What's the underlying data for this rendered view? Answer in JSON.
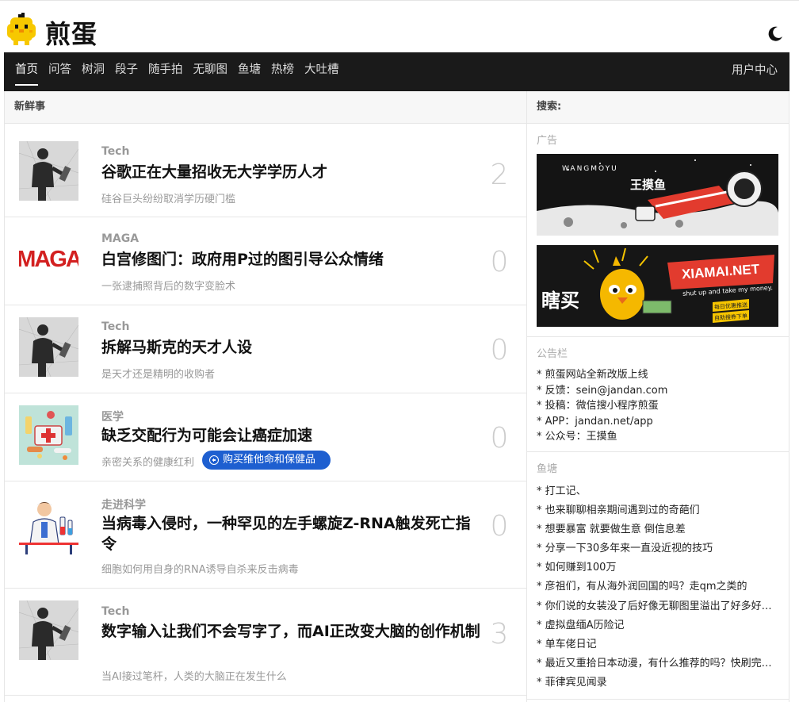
{
  "header": {
    "logo_text": "煎蛋"
  },
  "nav": {
    "items": [
      "首页",
      "问答",
      "树洞",
      "段子",
      "随手拍",
      "无聊图",
      "鱼塘",
      "热榜",
      "大吐槽"
    ],
    "user_center": "用户中心"
  },
  "main": {
    "section_title": "新鲜事",
    "posts": [
      {
        "category": "Tech",
        "title": "谷歌正在大量招收无大学学历人才",
        "subtitle": "硅谷巨头纷纷取消学历硬门槛",
        "count": "2",
        "thumb": "tech"
      },
      {
        "category": "MAGA",
        "title": "白宫修图门：政府用P过的图引导公众情绪",
        "subtitle": "一张逮捕照背后的数字变脸术",
        "count": "0",
        "thumb": "maga"
      },
      {
        "category": "Tech",
        "title": "拆解马斯克的天才人设",
        "subtitle": "是天才还是精明的收购者",
        "count": "0",
        "thumb": "tech"
      },
      {
        "category": "医学",
        "title": "缺乏交配行为可能会让癌症加速",
        "subtitle": "亲密关系的健康红利",
        "count": "0",
        "thumb": "medical"
      },
      {
        "category": "走进科学",
        "title": "当病毒入侵时，一种罕见的左手螺旋Z-RNA触发死亡指令",
        "subtitle": "细胞如何用自身的RNA诱导自杀来反击病毒",
        "count": "0",
        "thumb": "science"
      },
      {
        "category": "Tech",
        "title": "数字输入让我们不会写字了，而AI正改变大脑的创作机制",
        "subtitle": "当AI接过笔杆，人类的大脑正在发生什么",
        "count": "3",
        "thumb": "tech"
      }
    ],
    "promo_pill": "购买维他命和保健品"
  },
  "sidebar": {
    "search_label": "搜索:",
    "ads_title": "广告",
    "ads": [
      {
        "brand_cn": "王摸鱼",
        "brand_en": "WANGMOYU"
      },
      {
        "brand_cn": "瞎买",
        "brand_en": "XIAMAI.NET",
        "tagline": "shut up and take my money.",
        "badge1": "每日优惠推送",
        "badge2": "自助搜券下单"
      }
    ],
    "notice_title": "公告栏",
    "notices": [
      "* 煎蛋网站全新改版上线",
      "* 反馈：sein@jandan.com",
      "* 投稿：微信搜小程序煎蛋",
      "* APP：jandan.net/app",
      "* 公众号：王摸鱼"
    ],
    "pond_title": "鱼塘",
    "pond_items": [
      "* 打工记、",
      "* 也来聊聊相亲期间遇到过的奇葩们",
      "* 想要暴富 就要做生意 倒信息差",
      "* 分享一下30多年来一直没近视的技巧",
      "* 如何赚到100万",
      "* 彦祖们，有从海外润回国的吗？走qm之类的",
      "* 你们说的女装没了后好像无聊图里溢出了好多好…",
      "* 虚拟盘缅A历险记",
      "* 单车佬日记",
      "* 最近又重拾日本动漫，有什么推荐的吗？快刷完…",
      "* 菲律宾见闻录"
    ]
  },
  "colors": {
    "nav_bg": "#1a1a1a",
    "pill_blue": "#1e5fd0",
    "chick_yellow": "#f7c800"
  }
}
